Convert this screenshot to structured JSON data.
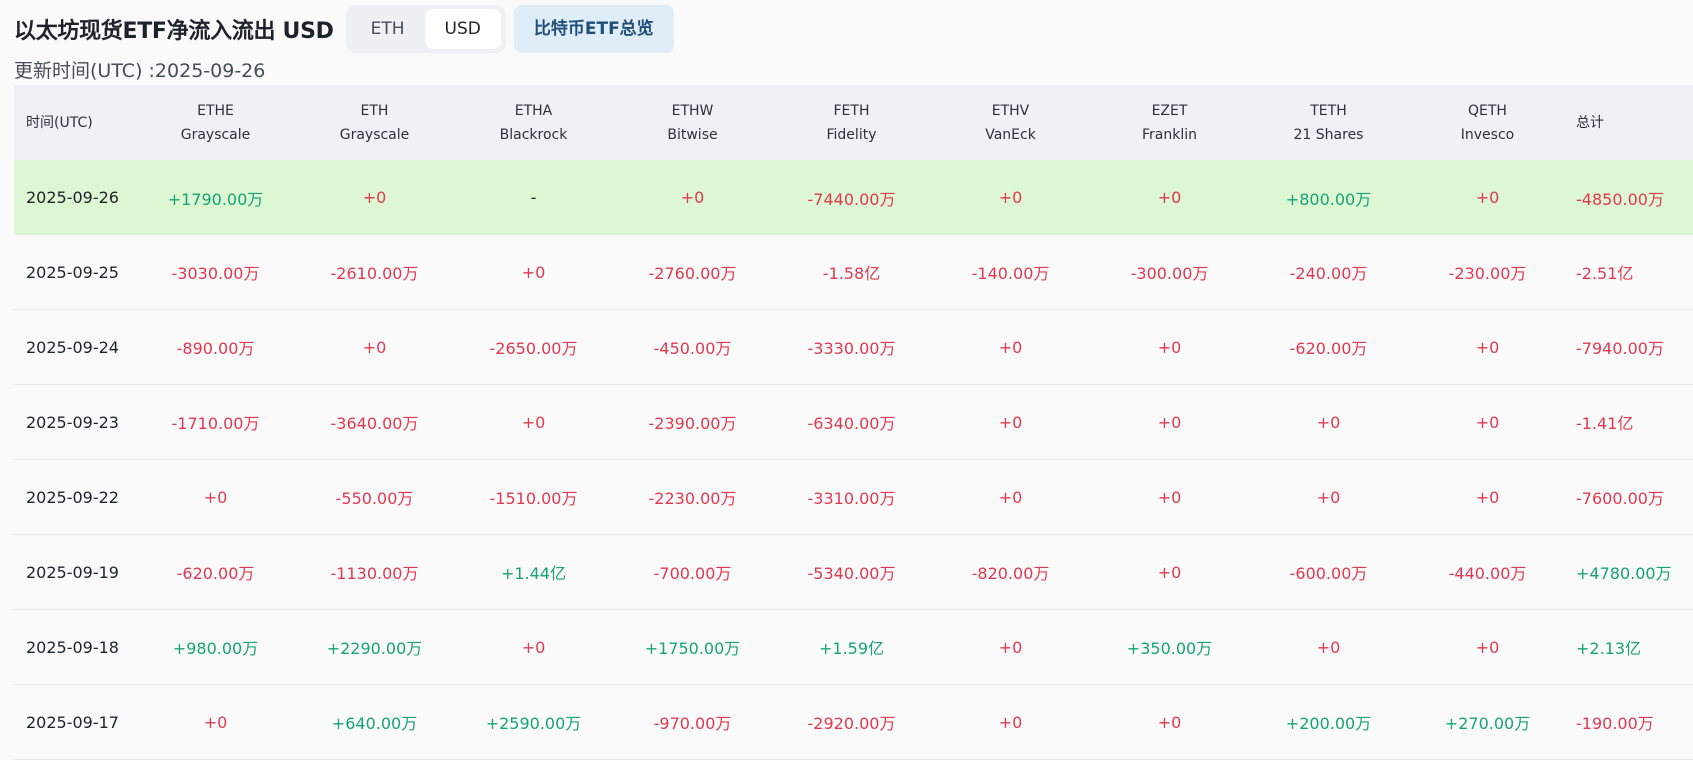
{
  "header": {
    "title": "以太坊现货ETF净流入流出 USD",
    "unit_buttons": [
      {
        "label": "ETH",
        "active": false
      },
      {
        "label": "USD",
        "active": true
      }
    ],
    "overview_button": "比特币ETF总览",
    "updated_label": "更新时间(UTC) :2025-09-26"
  },
  "table": {
    "date_header": "时间(UTC)",
    "total_header": "总计",
    "columns": [
      {
        "ticker": "ETHE",
        "issuer": "Grayscale"
      },
      {
        "ticker": "ETH",
        "issuer": "Grayscale"
      },
      {
        "ticker": "ETHA",
        "issuer": "Blackrock"
      },
      {
        "ticker": "ETHW",
        "issuer": "Bitwise"
      },
      {
        "ticker": "FETH",
        "issuer": "Fidelity"
      },
      {
        "ticker": "ETHV",
        "issuer": "VanEck"
      },
      {
        "ticker": "EZET",
        "issuer": "Franklin"
      },
      {
        "ticker": "TETH",
        "issuer": "21 Shares"
      },
      {
        "ticker": "QETH",
        "issuer": "Invesco"
      }
    ],
    "rows": [
      {
        "date": "2025-09-26",
        "values": [
          "+1790.00万",
          "+0",
          "-",
          "+0",
          "-7440.00万",
          "+0",
          "+0",
          "+800.00万",
          "+0"
        ],
        "total": "-4850.00万"
      },
      {
        "date": "2025-09-25",
        "values": [
          "-3030.00万",
          "-2610.00万",
          "+0",
          "-2760.00万",
          "-1.58亿",
          "-140.00万",
          "-300.00万",
          "-240.00万",
          "-230.00万"
        ],
        "total": "-2.51亿"
      },
      {
        "date": "2025-09-24",
        "values": [
          "-890.00万",
          "+0",
          "-2650.00万",
          "-450.00万",
          "-3330.00万",
          "+0",
          "+0",
          "-620.00万",
          "+0"
        ],
        "total": "-7940.00万"
      },
      {
        "date": "2025-09-23",
        "values": [
          "-1710.00万",
          "-3640.00万",
          "+0",
          "-2390.00万",
          "-6340.00万",
          "+0",
          "+0",
          "+0",
          "+0"
        ],
        "total": "-1.41亿"
      },
      {
        "date": "2025-09-22",
        "values": [
          "+0",
          "-550.00万",
          "-1510.00万",
          "-2230.00万",
          "-3310.00万",
          "+0",
          "+0",
          "+0",
          "+0"
        ],
        "total": "-7600.00万"
      },
      {
        "date": "2025-09-19",
        "values": [
          "-620.00万",
          "-1130.00万",
          "+1.44亿",
          "-700.00万",
          "-5340.00万",
          "-820.00万",
          "+0",
          "-600.00万",
          "-440.00万"
        ],
        "total": "+4780.00万"
      },
      {
        "date": "2025-09-18",
        "values": [
          "+980.00万",
          "+2290.00万",
          "+0",
          "+1750.00万",
          "+1.59亿",
          "+0",
          "+350.00万",
          "+0",
          "+0"
        ],
        "total": "+2.13亿"
      },
      {
        "date": "2025-09-17",
        "values": [
          "+0",
          "+640.00万",
          "+2590.00万",
          "-970.00万",
          "-2920.00万",
          "+0",
          "+0",
          "+200.00万",
          "+270.00万"
        ],
        "total": "-190.00万"
      }
    ]
  },
  "colors": {
    "positive": "#16a376",
    "negative": "#e0394f",
    "highlight_row": "#dcf7d2",
    "header_bg": "#eef2f6",
    "overview_button_bg": "#dfedf9"
  }
}
